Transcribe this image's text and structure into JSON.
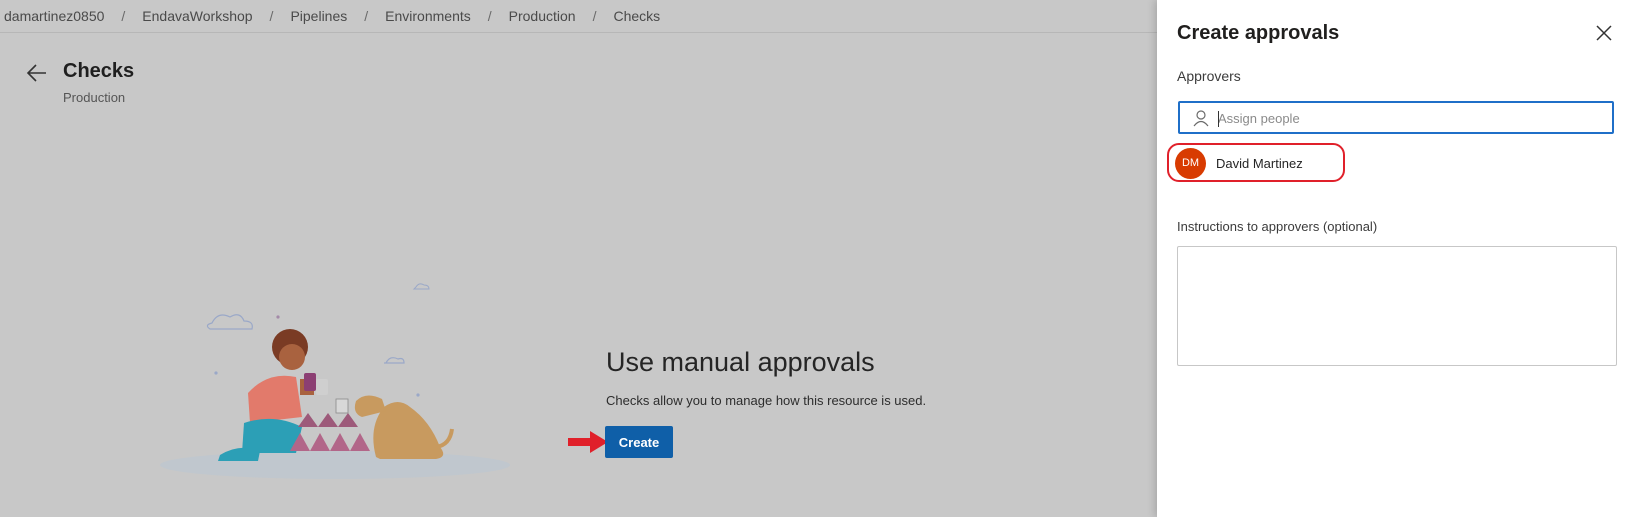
{
  "breadcrumb": {
    "items": [
      "damartinez0850",
      "EndavaWorkshop",
      "Pipelines",
      "Environments",
      "Production",
      "Checks"
    ],
    "separator": "/"
  },
  "header": {
    "title": "Checks",
    "subtitle": "Production"
  },
  "empty_state": {
    "title": "Use manual approvals",
    "description": "Checks allow you to manage how this resource is used.",
    "create_label": "Create"
  },
  "panel": {
    "title": "Create approvals",
    "approvers_label": "Approvers",
    "assign_placeholder": "Assign people",
    "approver": {
      "initials": "DM",
      "name": "David Martinez"
    },
    "instructions_label": "Instructions to approvers (optional)",
    "instructions_value": ""
  },
  "colors": {
    "primary_button": "#0f5fa8",
    "avatar": "#d83b01",
    "highlight": "#e0202a"
  }
}
